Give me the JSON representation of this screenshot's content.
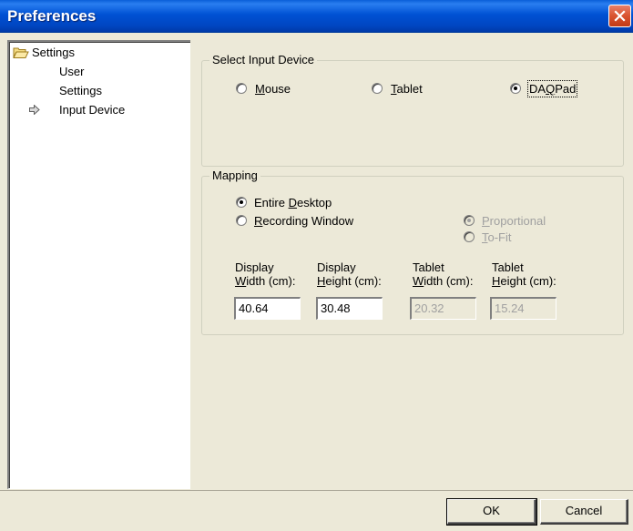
{
  "window": {
    "title": "Preferences",
    "close_icon": "close-icon"
  },
  "tree": {
    "root_label": "Settings",
    "root_icon": "folder-open-icon",
    "children": [
      {
        "label": "User"
      },
      {
        "label": "Settings"
      },
      {
        "label": "Input Device",
        "selected_icon": "arrow-right-icon"
      }
    ]
  },
  "input_device": {
    "group_label": "Select Input Device",
    "options": [
      {
        "pre": "",
        "accel": "M",
        "post": "ouse",
        "checked": false
      },
      {
        "pre": "",
        "accel": "T",
        "post": "ablet",
        "checked": false
      },
      {
        "pre": "DA",
        "accel": "Q",
        "post": "Pad",
        "checked": true
      }
    ]
  },
  "mapping": {
    "group_label": "Mapping",
    "entire_desktop": {
      "pre": "Entire ",
      "accel": "D",
      "post": "esktop",
      "checked": true
    },
    "recording_window": {
      "pre": "",
      "accel": "R",
      "post": "ecording Window",
      "checked": false
    },
    "proportional": {
      "pre": "",
      "accel": "P",
      "post": "roportional",
      "checked": true,
      "disabled": true
    },
    "to_fit": {
      "pre": "",
      "accel": "T",
      "post": "o-Fit",
      "checked": false,
      "disabled": true
    },
    "fields": [
      {
        "line1": "Display",
        "line2_pre": "",
        "line2_accel": "W",
        "line2_post": "idth (cm):",
        "value": "40.64",
        "disabled": false
      },
      {
        "line1": "Display",
        "line2_pre": "",
        "line2_accel": "H",
        "line2_post": "eight (cm):",
        "value": "30.48",
        "disabled": false
      },
      {
        "line1": "Tablet",
        "line2_pre": "",
        "line2_accel": "W",
        "line2_post": "idth (cm):",
        "value": "20.32",
        "disabled": true
      },
      {
        "line1": "Tablet",
        "line2_pre": "",
        "line2_accel": "H",
        "line2_post": "eight (cm):",
        "value": "15.24",
        "disabled": true
      }
    ]
  },
  "buttons": {
    "ok_label": "OK",
    "cancel_label": "Cancel"
  }
}
